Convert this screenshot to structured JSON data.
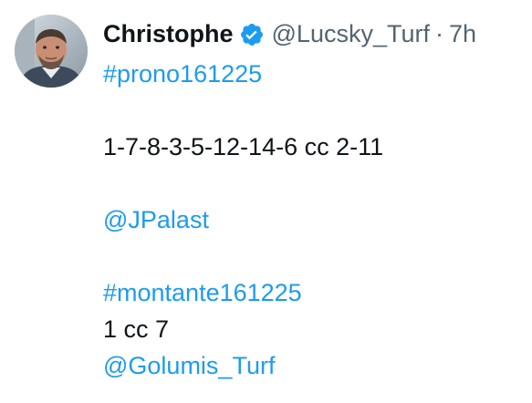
{
  "tweet": {
    "author_name": "Christophe",
    "handle": "@Lucsky_Turf",
    "separator": "·",
    "time": "7h",
    "colors": {
      "text": "#0f1419",
      "secondary": "#536471",
      "link": "#1d9bf0",
      "verified": "#1d9bf0"
    },
    "icons": {
      "verified": "verified-badge-icon",
      "avatar": "profile-photo"
    },
    "content": {
      "hashtag_1": "#prono161225",
      "line_numbers": "1-7-8-3-5-12-14-6 cc 2-11",
      "mention_1": "@JPalast",
      "hashtag_2": "#montante161225",
      "line_pick": "1 cc 7",
      "mention_2": "@Golumis_Turf"
    }
  }
}
